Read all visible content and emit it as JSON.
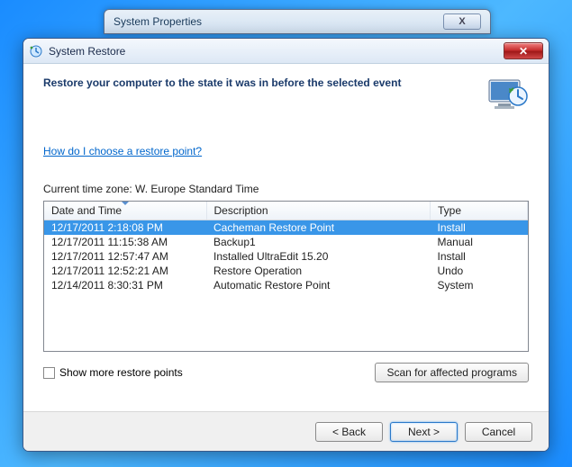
{
  "bg_window": {
    "title": "System Properties"
  },
  "window": {
    "title": "System Restore"
  },
  "page": {
    "heading": "Restore your computer to the state it was in before the selected event",
    "help_link": "How do I choose a restore point?",
    "timezone_label": "Current time zone: W. Europe Standard Time"
  },
  "table": {
    "columns": {
      "datetime": "Date and Time",
      "description": "Description",
      "type": "Type"
    },
    "rows": [
      {
        "datetime": "12/17/2011 2:18:08 PM",
        "description": "Cacheman Restore Point",
        "type": "Install",
        "selected": true
      },
      {
        "datetime": "12/17/2011 11:15:38 AM",
        "description": "Backup1",
        "type": "Manual",
        "selected": false
      },
      {
        "datetime": "12/17/2011 12:57:47 AM",
        "description": "Installed UltraEdit 15.20",
        "type": "Install",
        "selected": false
      },
      {
        "datetime": "12/17/2011 12:52:21 AM",
        "description": "Restore Operation",
        "type": "Undo",
        "selected": false
      },
      {
        "datetime": "12/14/2011 8:30:31 PM",
        "description": "Automatic Restore Point",
        "type": "System",
        "selected": false
      }
    ]
  },
  "controls": {
    "show_more": "Show more restore points",
    "scan_btn": "Scan for affected programs",
    "back_btn": "< Back",
    "next_btn": "Next >",
    "cancel_btn": "Cancel"
  }
}
